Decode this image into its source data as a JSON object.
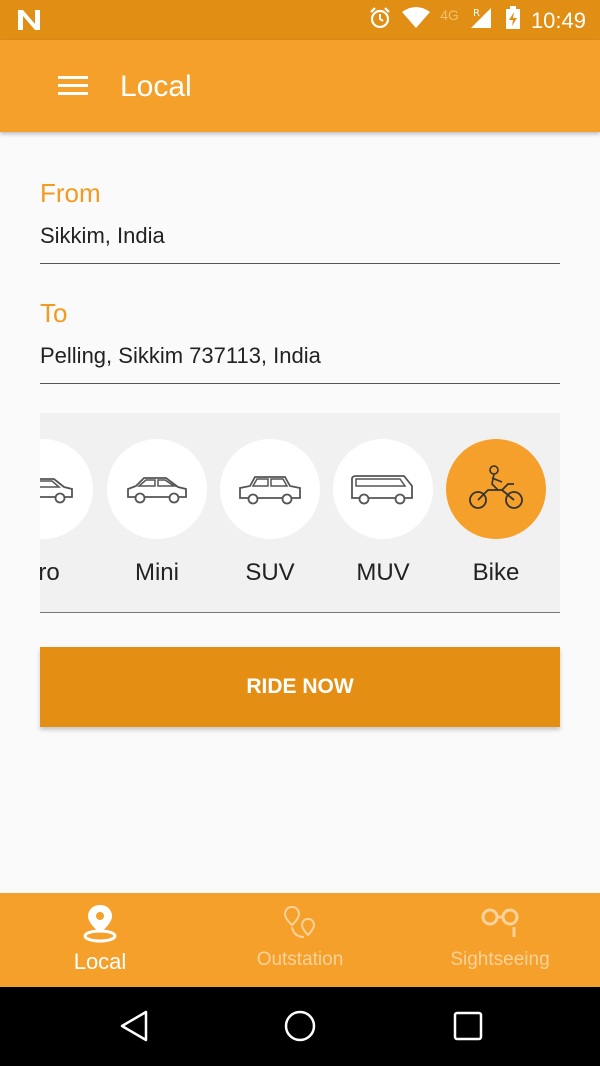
{
  "status_bar": {
    "time": "10:49",
    "network": "4G",
    "roaming": "R"
  },
  "app_bar": {
    "title": "Local"
  },
  "form": {
    "from_label": "From",
    "from_value": "Sikkim, India",
    "to_label": "To",
    "to_value": "Pelling, Sikkim 737113, India"
  },
  "vehicles": {
    "items": [
      {
        "label": "cro",
        "icon": "car-icon"
      },
      {
        "label": "Mini",
        "icon": "hatchback-icon"
      },
      {
        "label": "SUV",
        "icon": "suv-icon"
      },
      {
        "label": "MUV",
        "icon": "van-icon"
      },
      {
        "label": "Bike",
        "icon": "motorbike-icon"
      }
    ],
    "selected": "Bike"
  },
  "ride_button": {
    "label": "RIDE NOW"
  },
  "bottom_nav": {
    "items": [
      {
        "label": "Local",
        "icon": "location-pin-icon"
      },
      {
        "label": "Outstation",
        "icon": "route-pins-icon"
      },
      {
        "label": "Sightseeing",
        "icon": "binoculars-icon"
      }
    ],
    "active": "Local"
  },
  "colors": {
    "primary": "#f5a02a",
    "primary_dark": "#e08e14",
    "accent_text": "#f29b1f",
    "button": "#e48f13"
  }
}
